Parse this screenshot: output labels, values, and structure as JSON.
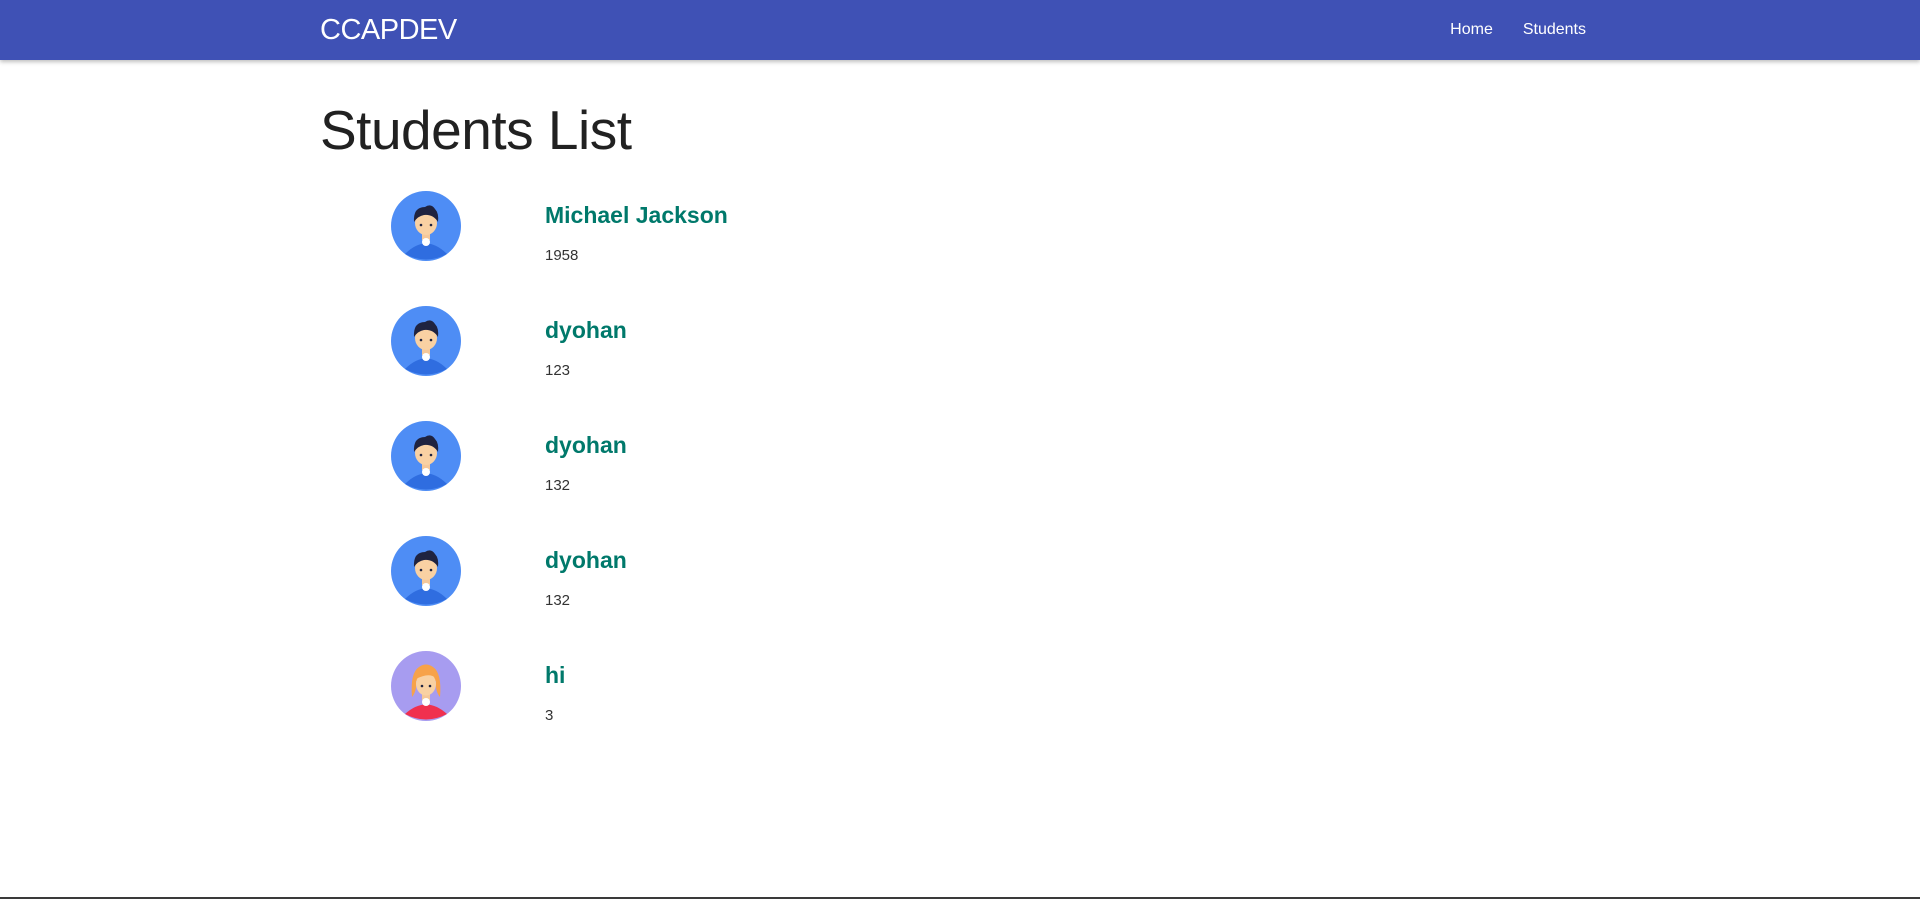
{
  "navbar": {
    "brand": "CCAPDEV",
    "links": [
      {
        "label": "Home"
      },
      {
        "label": "Students"
      }
    ],
    "color": "#3f51b5"
  },
  "page": {
    "title": "Students List"
  },
  "students": [
    {
      "name": "Michael Jackson",
      "value": "1958",
      "avatar": "male-avatar-icon"
    },
    {
      "name": "dyohan",
      "value": "123",
      "avatar": "male-avatar-icon"
    },
    {
      "name": "dyohan",
      "value": "132",
      "avatar": "male-avatar-icon"
    },
    {
      "name": "dyohan",
      "value": "132",
      "avatar": "male-avatar-icon"
    },
    {
      "name": "hi",
      "value": "3",
      "avatar": "female-avatar-icon"
    }
  ],
  "colors": {
    "name_text": "#00796b",
    "male_avatar_bg": "#4e8df5",
    "female_avatar_bg": "#a79cf0"
  }
}
